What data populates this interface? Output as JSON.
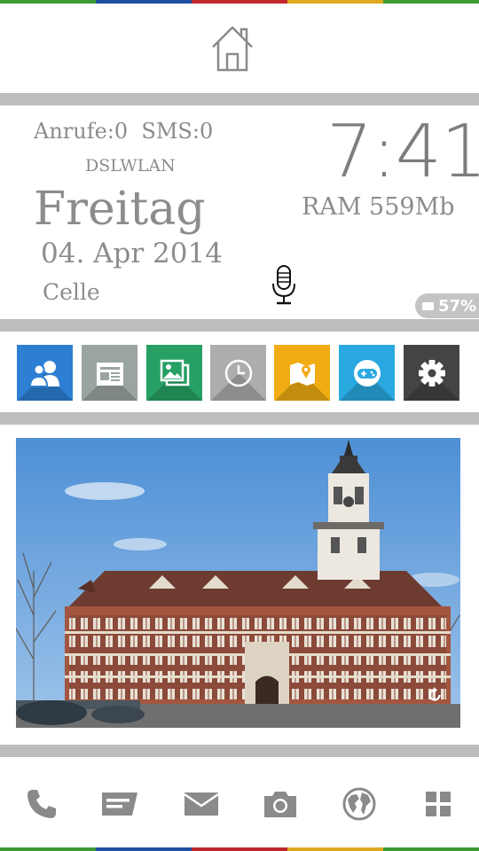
{
  "colors": {
    "stripe": [
      "#3d9b35",
      "#1e4fa3",
      "#c0272d",
      "#e0a820",
      "#3d9b35"
    ],
    "divider": "#bdbdbd",
    "text": "#8c8c8c",
    "icon_gray": "#8a8a8a",
    "tiles": [
      "#2d7fd3",
      "#9aa5a3",
      "#27a065",
      "#adadad",
      "#f1ac14",
      "#29a9e0",
      "#444444"
    ]
  },
  "header": {
    "home_icon": "home-outline-icon"
  },
  "status": {
    "calls_sms": "Anrufe:0  SMS:0",
    "network": "DSLWLAN",
    "weekday": "Freitag",
    "date": "04. Apr 2014",
    "city": "Celle",
    "time": "7:41",
    "ram": "RAM 559Mb",
    "battery": "57%",
    "mic_icon": "microphone-icon"
  },
  "apps": [
    {
      "icon": "contacts-icon"
    },
    {
      "icon": "news-icon"
    },
    {
      "icon": "gallery-icon"
    },
    {
      "icon": "clock-icon"
    },
    {
      "icon": "map-icon"
    },
    {
      "icon": "gamepad-icon"
    },
    {
      "icon": "settings-gear-icon"
    }
  ],
  "photo": {
    "subject": "castle-photo",
    "refresh_icon": "refresh-icon"
  },
  "dock": [
    {
      "icon": "phone-icon"
    },
    {
      "icon": "messaging-icon"
    },
    {
      "icon": "mail-icon"
    },
    {
      "icon": "camera-icon"
    },
    {
      "icon": "globe-icon"
    },
    {
      "icon": "app-grid-icon"
    }
  ]
}
